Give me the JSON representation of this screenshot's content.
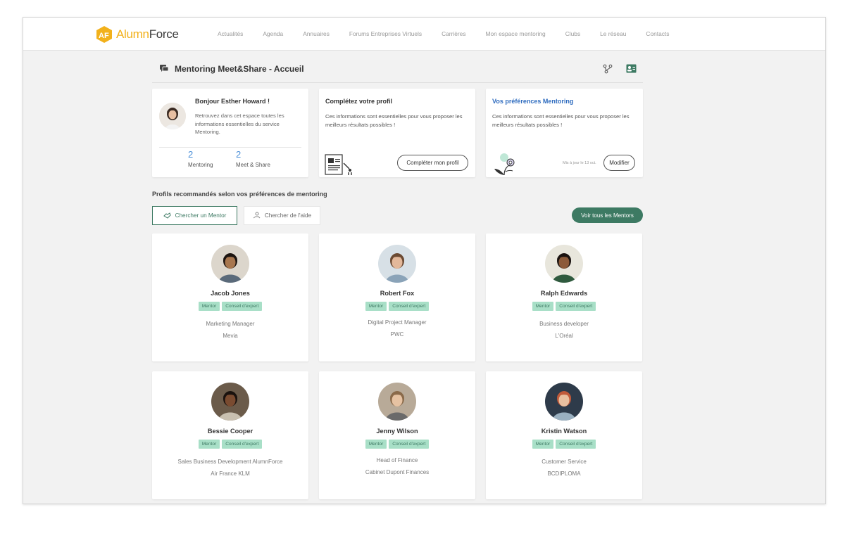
{
  "brand": {
    "name_part1": "Alumn",
    "name_part2": "Force",
    "accent": "#f2b11b",
    "primary": "#3d7a63",
    "link_blue": "#2f6cbf"
  },
  "nav": {
    "items": [
      "Actualités",
      "Agenda",
      "Annuaires",
      "Forums Entreprises Virtuels",
      "Carrières",
      "Mon espace mentoring",
      "Clubs",
      "Le réseau",
      "Contacts"
    ]
  },
  "header": {
    "title": "Mentoring Meet&Share - Accueil",
    "icons": [
      "chat-icon",
      "tree-icon",
      "contact-card-icon"
    ]
  },
  "welcome": {
    "greeting": "Bonjour Esther Howard !",
    "description": "Retrouvez dans cet espace toutes les informations essentielles du service Mentoring.",
    "stats": [
      {
        "value": "2",
        "label": "Mentoring"
      },
      {
        "value": "2",
        "label": "Meet & Share"
      }
    ]
  },
  "profile_panel": {
    "title": "Complétez votre profil",
    "description": "Ces informations sont essentielles pour vous proposer les meilleurs résultats possibles !",
    "button": "Compléter mon profil"
  },
  "prefs_panel": {
    "title": "Vos préférences Mentoring",
    "description": "Ces informations sont essentielles pour vous proposer les meilleurs résultats possibles !",
    "updated": "Mis à jour le 13 oct.",
    "button": "Modifier"
  },
  "recommendations": {
    "title": "Profils recommandés selon vos préférences de mentoring",
    "tabs": [
      "Chercher un Mentor",
      "Chercher de l'aide"
    ],
    "see_all": "Voir tous les Mentors",
    "profiles": [
      {
        "name": "Jacob Jones",
        "tags": [
          "Mentor",
          "Conseil d'expert"
        ],
        "role": "Marketing Manager",
        "company": "Mevia"
      },
      {
        "name": "Robert Fox",
        "tags": [
          "Mentor",
          "Conseil d'expert"
        ],
        "role": "Digital Project Manager",
        "company": "PWC"
      },
      {
        "name": "Ralph Edwards",
        "tags": [
          "Mentor",
          "Conseil d'expert"
        ],
        "role": "Business developer",
        "company": "L'Oréal"
      },
      {
        "name": "Bessie Cooper",
        "tags": [
          "Mentor",
          "Conseil d'expert"
        ],
        "role": "Sales Business Development AlumnForce",
        "company": "Air France KLM"
      },
      {
        "name": "Jenny Wilson",
        "tags": [
          "Mentor",
          "Conseil d'expert"
        ],
        "role": "Head of Finance",
        "company": "Cabinet Dupont Finances"
      },
      {
        "name": "Kristin Watson",
        "tags": [
          "Mentor",
          "Conseil d'expert"
        ],
        "role": "Customer Service",
        "company": "BCDIPLOMA"
      }
    ]
  }
}
